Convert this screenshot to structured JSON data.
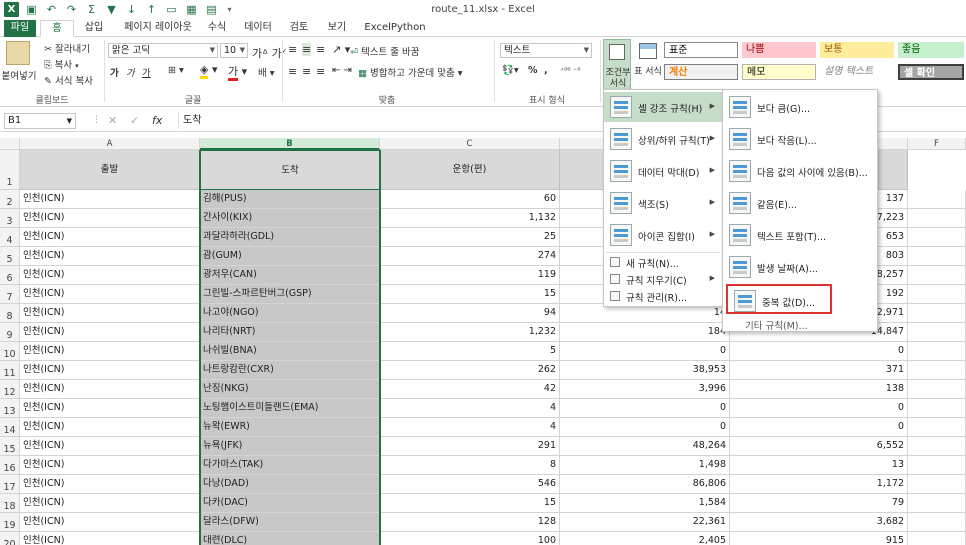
{
  "window": {
    "title": "route_11.xlsx - Excel"
  },
  "tabs": [
    "파일",
    "홈",
    "삽입",
    "페이지 레이아웃",
    "수식",
    "데이터",
    "검토",
    "보기",
    "ExcelPython"
  ],
  "ribbon": {
    "clipboard": {
      "paste": "붙여넣기",
      "cut": "잘라내기",
      "copy": "복사",
      "format_painter": "서식 복사",
      "label": "클립보드"
    },
    "font": {
      "name": "맑은 고딕",
      "size": "10",
      "label": "글꼴",
      "bold": "가",
      "italic": "가",
      "underline": "가"
    },
    "alignment": {
      "wrap": "텍스트 줄 바꿈",
      "merge": "병합하고 가운데 맞춤",
      "label": "맞춤"
    },
    "number": {
      "format": "텍스트",
      "percent": "%",
      "comma": ",",
      "label": "표시 형식"
    },
    "conditional": "조건부 서식",
    "table": "표 서식",
    "styles": {
      "normal": "표준",
      "bad": "나쁨",
      "neutral": "보통",
      "good": "좋음",
      "calc": "계산",
      "memo": "메모",
      "explain": "설명 텍스트",
      "check": "셀 확인"
    }
  },
  "formula": {
    "namebox": "B1",
    "fx": "fx",
    "value": "도착"
  },
  "grid": {
    "columns": [
      "A",
      "B",
      "C",
      "D",
      "E",
      "F"
    ],
    "headers": [
      "출발",
      "도착",
      "운항(편)"
    ],
    "rows": [
      {
        "n": "2",
        "a": "인천(ICN)",
        "b": "김해(PUS)",
        "c": "60",
        "d": "",
        "e": "137"
      },
      {
        "n": "3",
        "a": "인천(ICN)",
        "b": "간사이(KIX)",
        "c": "1,132",
        "d": "",
        "e": "7,223"
      },
      {
        "n": "4",
        "a": "인천(ICN)",
        "b": "과달라하라(GDL)",
        "c": "25",
        "d": "",
        "e": "653"
      },
      {
        "n": "5",
        "a": "인천(ICN)",
        "b": "괌(GUM)",
        "c": "274",
        "d": "",
        "e": "803"
      },
      {
        "n": "6",
        "a": "인천(ICN)",
        "b": "광저우(CAN)",
        "c": "119",
        "d": "",
        "e": "8,257"
      },
      {
        "n": "7",
        "a": "인천(ICN)",
        "b": "그린빌-스파르탄버그(GSP)",
        "c": "15",
        "d": "",
        "e": "192"
      },
      {
        "n": "8",
        "a": "인천(ICN)",
        "b": "나고야(NGO)",
        "c": "94",
        "d": "14",
        "e": "2,971"
      },
      {
        "n": "9",
        "a": "인천(ICN)",
        "b": "나리타(NRT)",
        "c": "1,232",
        "d": "184",
        "e": "14,847"
      },
      {
        "n": "10",
        "a": "인천(ICN)",
        "b": "나쉬빌(BNA)",
        "c": "5",
        "d": "0",
        "e": "0"
      },
      {
        "n": "11",
        "a": "인천(ICN)",
        "b": "나트랑캄란(CXR)",
        "c": "262",
        "d": "38,953",
        "e": "371"
      },
      {
        "n": "12",
        "a": "인천(ICN)",
        "b": "난징(NKG)",
        "c": "42",
        "d": "3,996",
        "e": "138"
      },
      {
        "n": "13",
        "a": "인천(ICN)",
        "b": "노팅햄이스트미들랜드(EMA)",
        "c": "4",
        "d": "0",
        "e": "0"
      },
      {
        "n": "14",
        "a": "인천(ICN)",
        "b": "뉴왁(EWR)",
        "c": "4",
        "d": "0",
        "e": "0"
      },
      {
        "n": "15",
        "a": "인천(ICN)",
        "b": "뉴욕(JFK)",
        "c": "291",
        "d": "48,264",
        "e": "6,552"
      },
      {
        "n": "16",
        "a": "인천(ICN)",
        "b": "다가마스(TAK)",
        "c": "8",
        "d": "1,498",
        "e": "13"
      },
      {
        "n": "17",
        "a": "인천(ICN)",
        "b": "다낭(DAD)",
        "c": "546",
        "d": "86,806",
        "e": "1,172"
      },
      {
        "n": "18",
        "a": "인천(ICN)",
        "b": "다카(DAC)",
        "c": "15",
        "d": "1,584",
        "e": "79"
      },
      {
        "n": "19",
        "a": "인천(ICN)",
        "b": "달라스(DFW)",
        "c": "128",
        "d": "22,361",
        "e": "3,682"
      },
      {
        "n": "20",
        "a": "인천(ICN)",
        "b": "대련(DLC)",
        "c": "100",
        "d": "2,405",
        "e": "915"
      }
    ]
  },
  "menu_cf": [
    {
      "label": "셀 강조 규칙(H)"
    },
    {
      "label": "상위/하위 규칙(T)"
    },
    {
      "label": "데이터 막대(D)"
    },
    {
      "label": "색조(S)"
    },
    {
      "label": "아이콘 집합(I)"
    },
    {
      "label": "새 규칙(N)..."
    },
    {
      "label": "규칙 지우기(C)"
    },
    {
      "label": "규칙 관리(R)..."
    }
  ],
  "menu_highlight": [
    {
      "label": "보다 큼(G)..."
    },
    {
      "label": "보다 작음(L)..."
    },
    {
      "label": "다음 값의 사이에 있음(B)..."
    },
    {
      "label": "같음(E)..."
    },
    {
      "label": "텍스트 포함(T)..."
    },
    {
      "label": "발생 날짜(A)..."
    },
    {
      "label": "중복 값(D)..."
    },
    {
      "label": "기타 규칙(M)..."
    }
  ],
  "colors": {
    "accent": "#217346",
    "highlight_box": "#e03030",
    "header_fill": "#d9d9d9",
    "selected_col": "#c8c8c8"
  }
}
